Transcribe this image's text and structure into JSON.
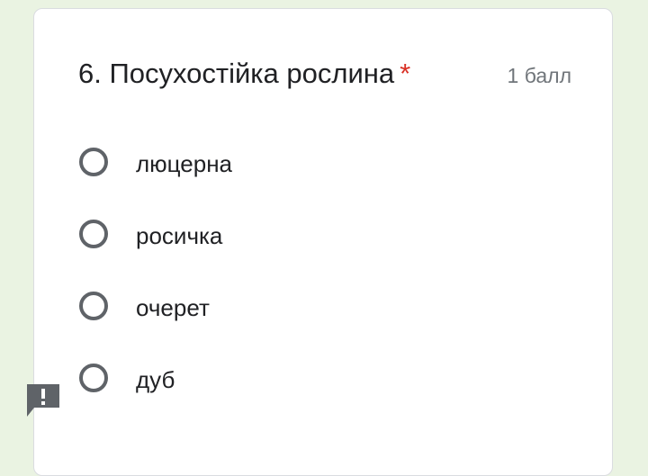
{
  "question": {
    "title": "6. Посухостійка рослина",
    "required_marker": "*",
    "points": "1 балл"
  },
  "options": [
    {
      "label": "люцерна",
      "selected": false
    },
    {
      "label": "росичка",
      "selected": false
    },
    {
      "label": "очерет",
      "selected": false
    },
    {
      "label": "дуб",
      "selected": false
    }
  ],
  "feedback": {
    "icon": "report-problem-icon"
  },
  "colors": {
    "background": "#eaf3e2",
    "card": "#ffffff",
    "required": "#d93025",
    "radio_border": "#5f6368"
  }
}
